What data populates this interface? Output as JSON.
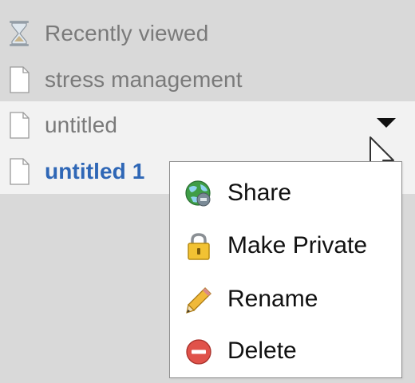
{
  "sidebar": {
    "items": [
      {
        "label": "Recently viewed",
        "icon": "hourglass-icon"
      },
      {
        "label": "stress management",
        "icon": "document-icon"
      },
      {
        "label": "untitled",
        "icon": "document-icon"
      },
      {
        "label": "untitled 1",
        "icon": "document-icon"
      }
    ]
  },
  "context_menu": {
    "items": [
      {
        "label": "Share",
        "icon": "share-globe-icon"
      },
      {
        "label": "Make Private",
        "icon": "lock-icon"
      },
      {
        "label": "Rename",
        "icon": "pencil-icon"
      },
      {
        "label": "Delete",
        "icon": "delete-icon"
      }
    ]
  },
  "colors": {
    "sidebar_bg": "#d9d9d9",
    "selected_row_bg": "#f2f2f2",
    "item_text": "#7a7a7a",
    "active_item_text": "#2f67b6",
    "menu_bg": "#ffffff",
    "menu_border": "#8f8f8f"
  }
}
